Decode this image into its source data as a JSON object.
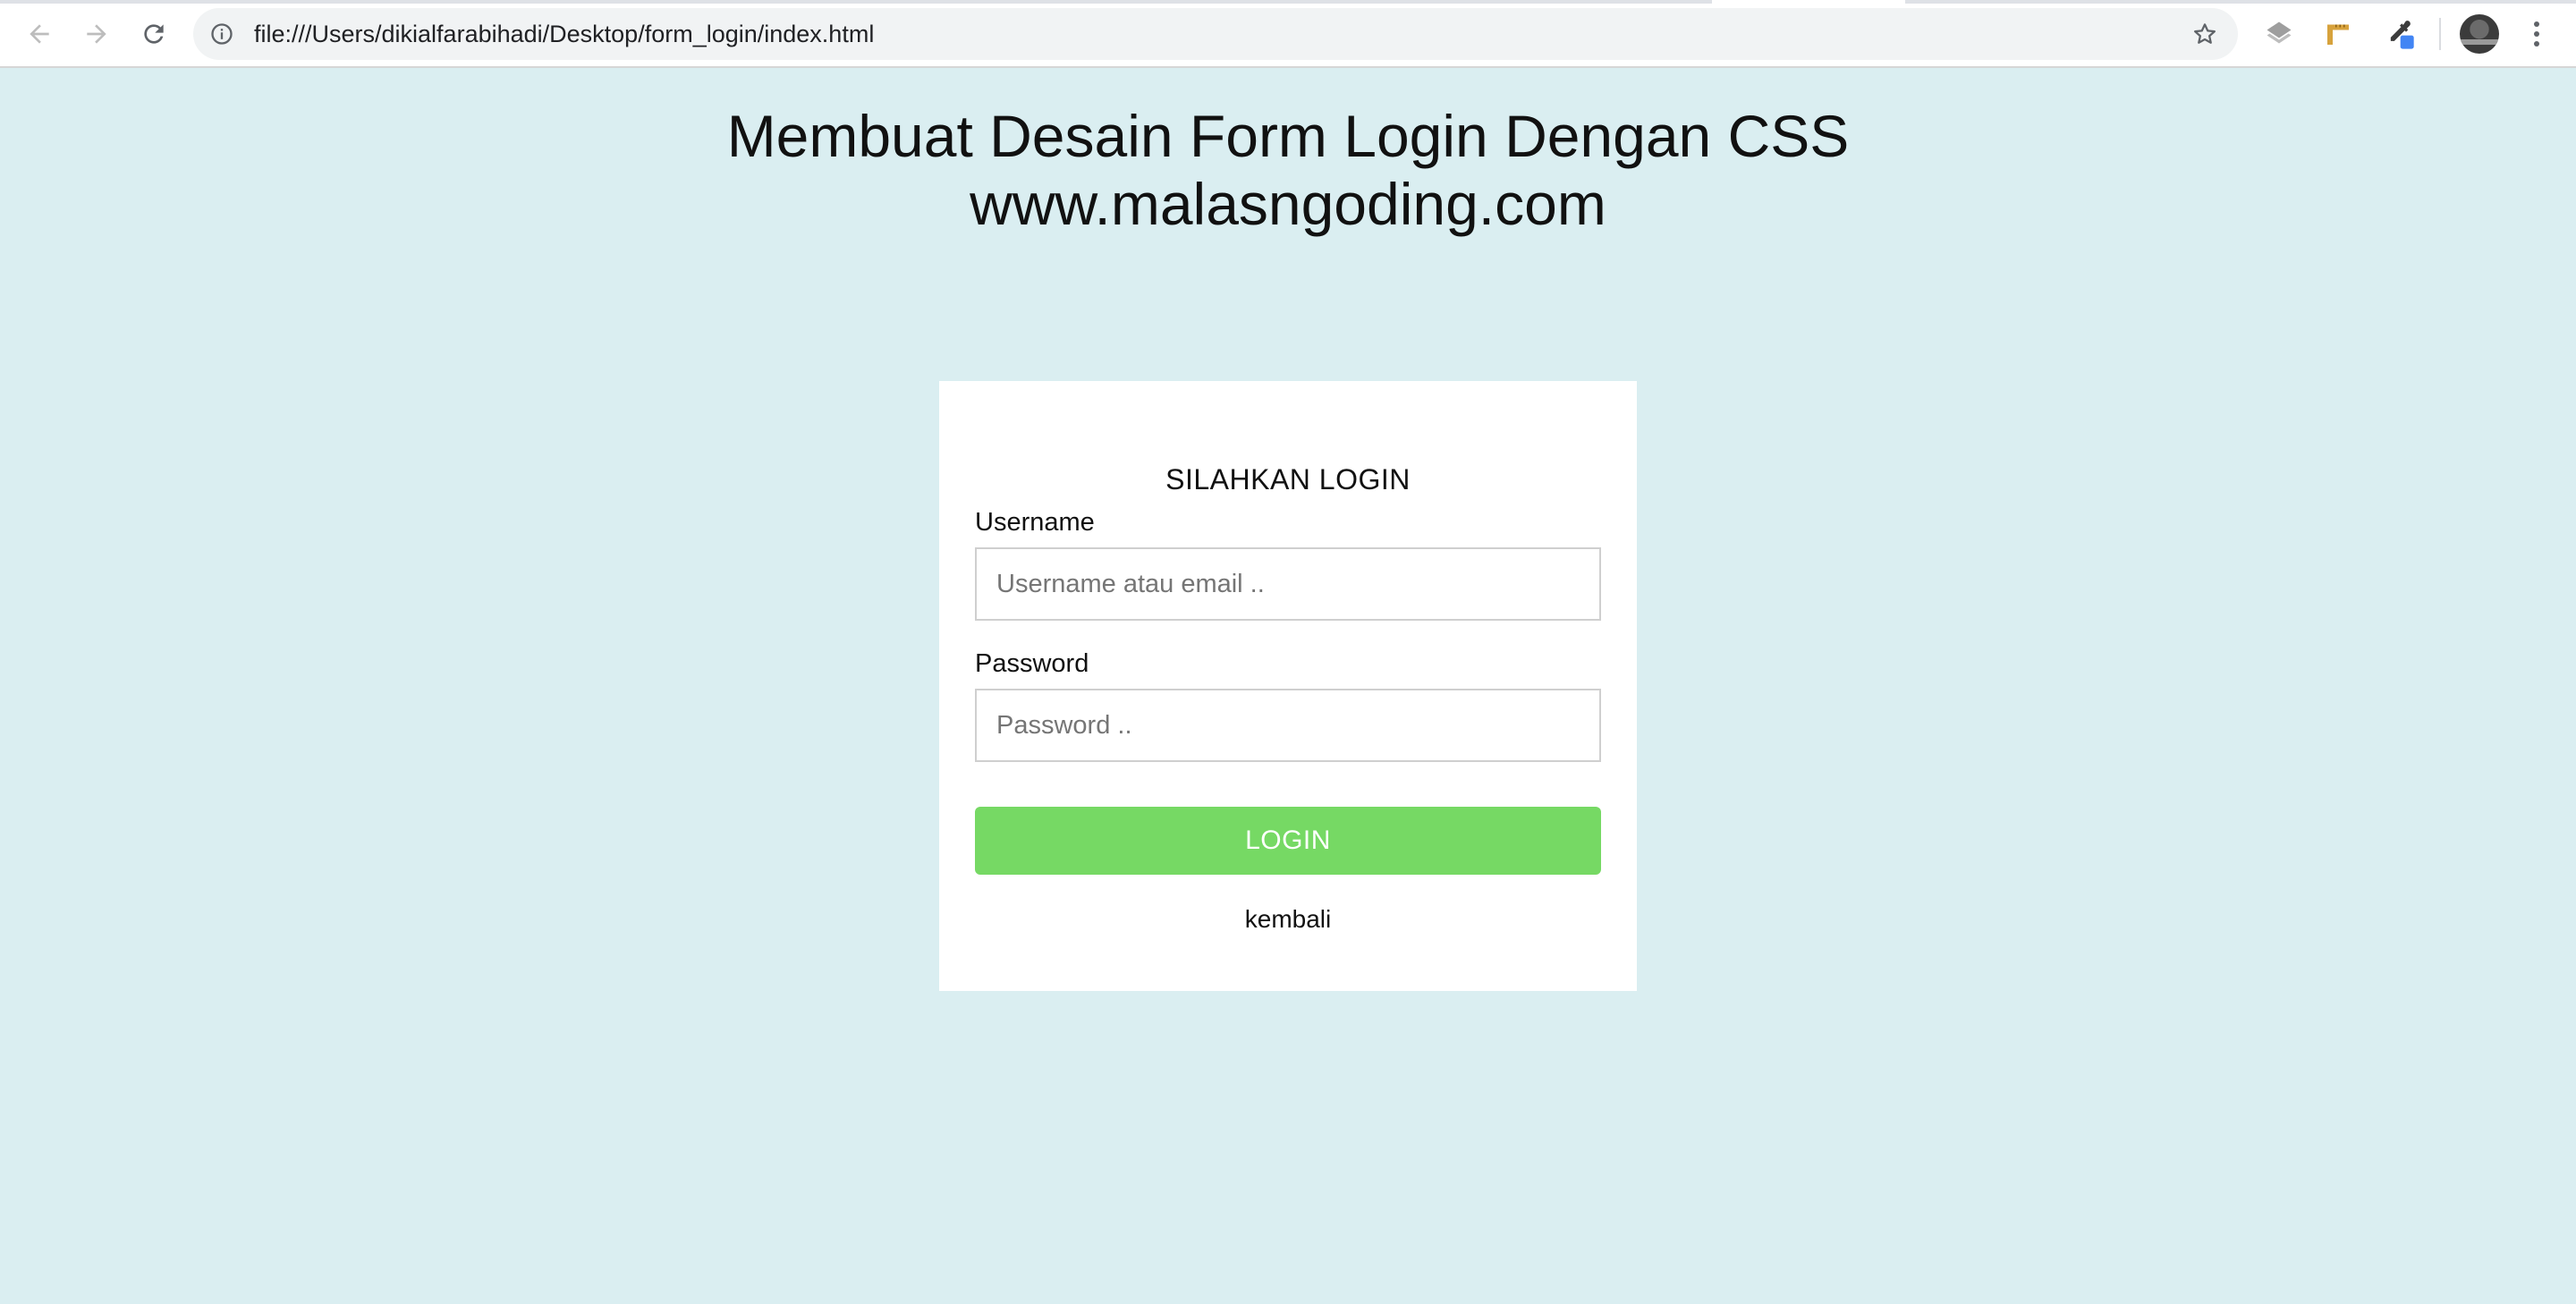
{
  "browser": {
    "url": "file:///Users/dikialfarabihadi/Desktop/form_login/index.html",
    "icons": {
      "back": "arrow-left-icon",
      "forward": "arrow-right-icon",
      "reload": "reload-icon",
      "info": "info-icon",
      "bookmark": "star-icon",
      "extensions": [
        "layers-extension-icon",
        "ruler-extension-icon",
        "eyedropper-extension-icon"
      ],
      "profile": "avatar",
      "menu": "more-vertical-icon"
    }
  },
  "page": {
    "title_line1": "Membuat Desain Form Login Dengan CSS",
    "title_line2": "www.malasngoding.com",
    "background": "#daeef1"
  },
  "login_form": {
    "title": "SILAHKAN LOGIN",
    "username_label": "Username",
    "username_placeholder": "Username atau email ..",
    "username_value": "",
    "password_label": "Password",
    "password_placeholder": "Password ..",
    "password_value": "",
    "submit_label": "LOGIN",
    "submit_color": "#76d964",
    "back_link": "kembali"
  }
}
